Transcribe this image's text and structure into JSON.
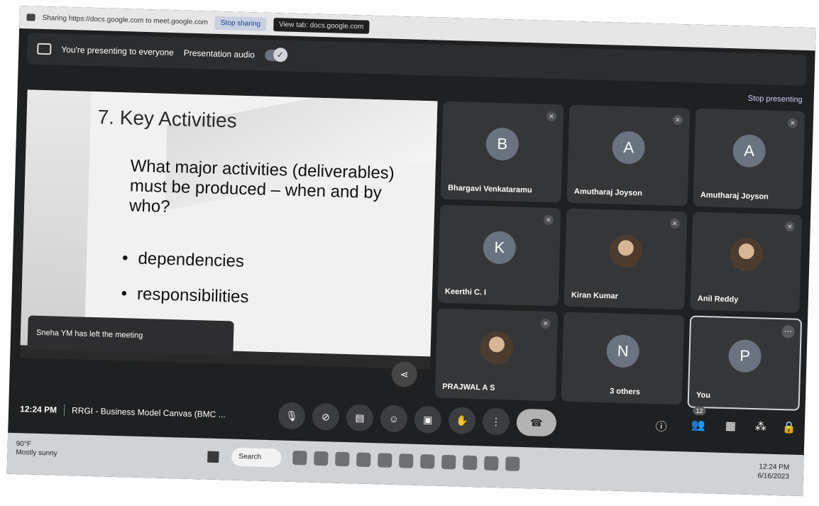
{
  "sharebar": {
    "message": "Sharing https://docs.google.com to meet.google.com",
    "stop_label": "Stop sharing",
    "view_label": "View tab: docs.google.com"
  },
  "presentbar": {
    "presenting_text": "You're presenting to everyone",
    "audio_label": "Presentation audio",
    "stop_presenting": "Stop presenting"
  },
  "slide": {
    "title": "7. Key Activities",
    "body": "What major activities (deliverables) must be produced – when and by who?",
    "bullets": [
      "dependencies",
      "responsibilities"
    ]
  },
  "toast": "Sneha YM has left the meeting",
  "participants": [
    {
      "initial": "B",
      "name": "Bhargavi Venkataramu"
    },
    {
      "initial": "A",
      "name": "Amutharaj Joyson"
    },
    {
      "initial": "A",
      "name": "Amutharaj Joyson"
    },
    {
      "initial": "K",
      "name": "Keerthi C. I"
    },
    {
      "initial": "",
      "name": "Kiran Kumar"
    },
    {
      "initial": "",
      "name": "Anil Reddy"
    },
    {
      "initial": "",
      "name": "PRAJWAL A S"
    },
    {
      "initial": "N",
      "name": "3 others"
    },
    {
      "initial": "P",
      "name": "You"
    }
  ],
  "meeting": {
    "time": "12:24 PM",
    "title": "RRGI - Business Model Canvas (BMC ...",
    "people_count": "12"
  },
  "taskbar": {
    "temp": "90°F",
    "weather": "Mostly sunny",
    "search": "Search",
    "clock_time": "12:24 PM",
    "clock_date": "6/16/2023"
  }
}
